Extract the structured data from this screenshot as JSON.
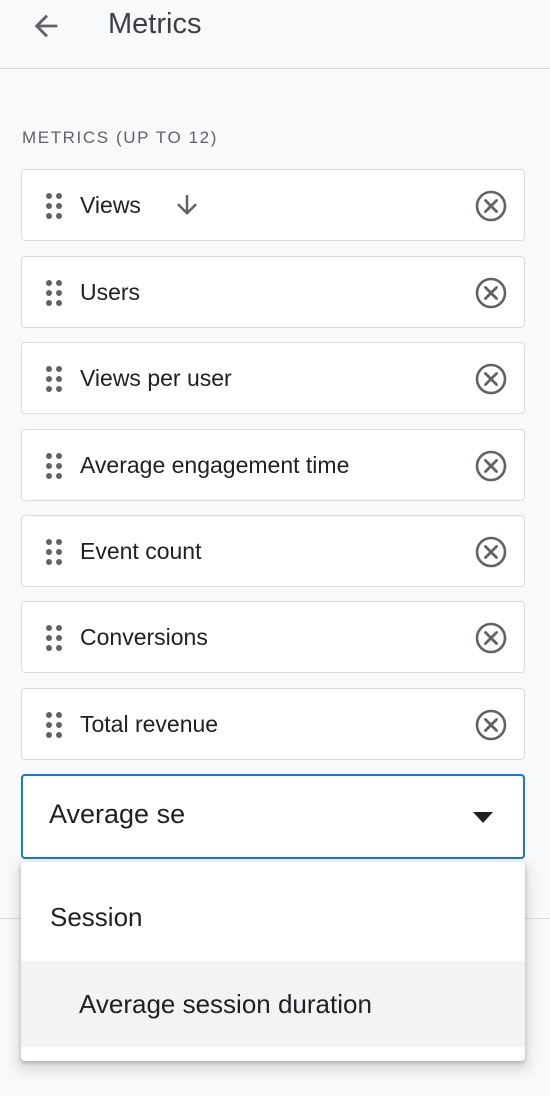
{
  "header": {
    "title": "Metrics",
    "back_icon": "arrow-back-icon"
  },
  "section": {
    "label": "METRICS (UP TO 12)"
  },
  "metrics": [
    {
      "label": "Views",
      "sorted": true,
      "sort_direction": "descending"
    },
    {
      "label": "Users"
    },
    {
      "label": "Views per user"
    },
    {
      "label": "Average engagement time"
    },
    {
      "label": "Event count"
    },
    {
      "label": "Conversions"
    },
    {
      "label": "Total revenue"
    }
  ],
  "search": {
    "value": "Average se",
    "dropdown_icon": "arrow-drop-down-icon"
  },
  "dropdown": {
    "group_label": "Session",
    "options": [
      {
        "label": "Average session duration",
        "highlighted": true
      }
    ]
  },
  "colors": {
    "accent": "#1a73e8",
    "background": "#f8f9fa",
    "border": "#dadce0",
    "icon": "#5f6368",
    "highlight": "#f1f3f4"
  }
}
